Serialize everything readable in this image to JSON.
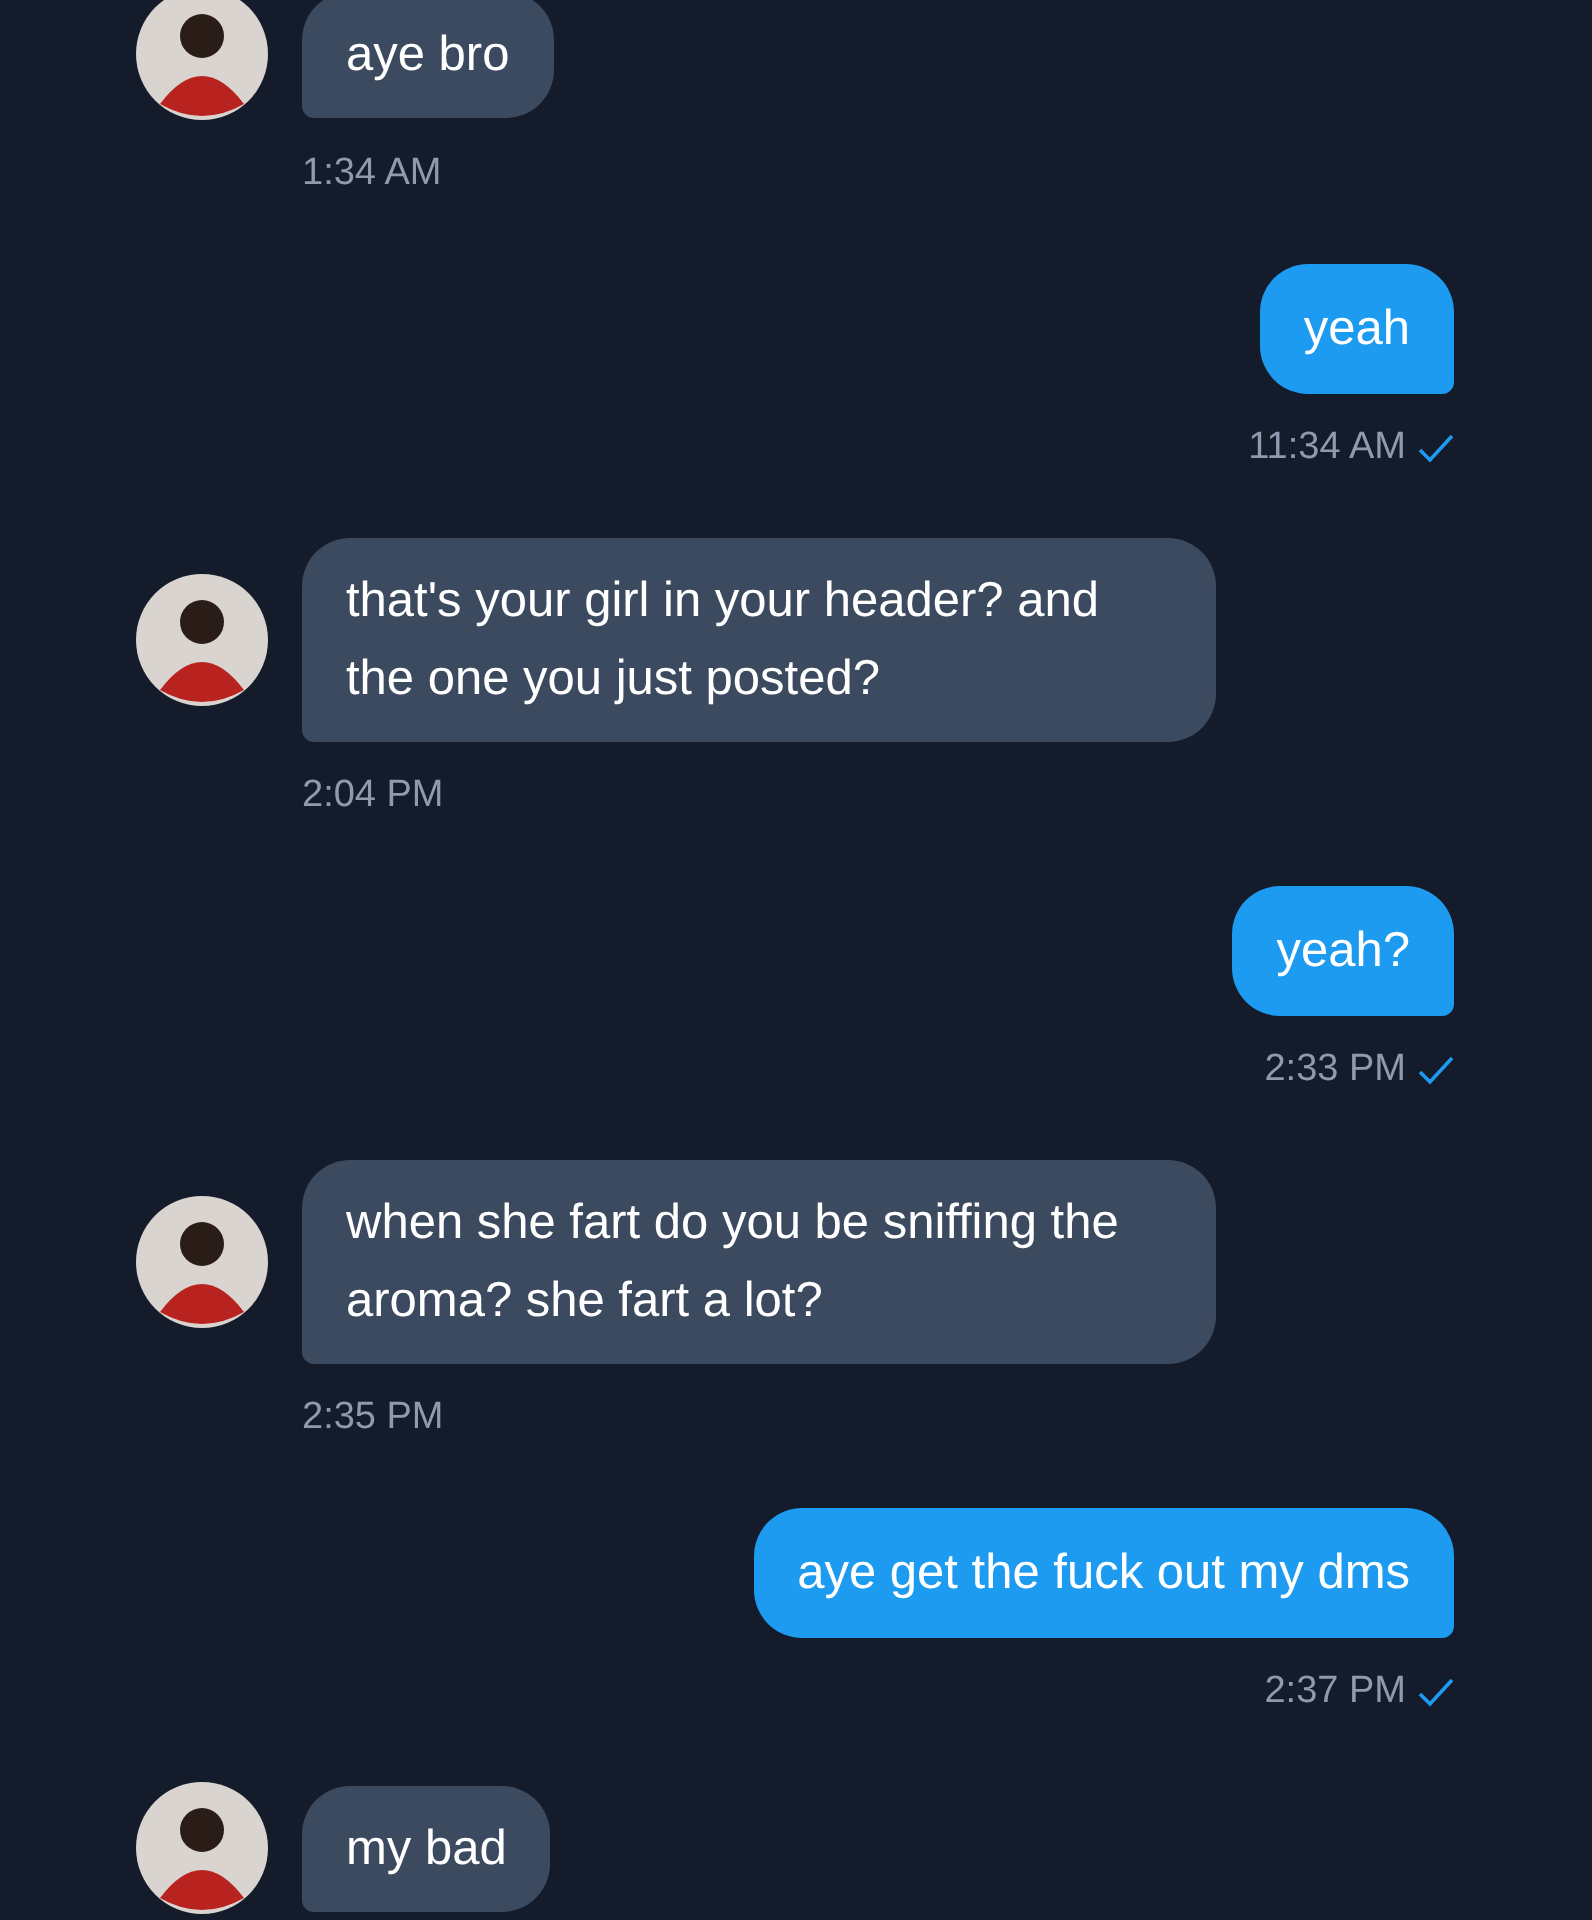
{
  "messages": [
    {
      "kind": "incoming",
      "text": "aye bro",
      "time": "1:34 AM"
    },
    {
      "kind": "outgoing",
      "text": "yeah",
      "time": "11:34 AM",
      "read": true
    },
    {
      "kind": "incoming",
      "text": "that's your girl in your header? and the one you just posted?",
      "time": "2:04 PM"
    },
    {
      "kind": "outgoing",
      "text": "yeah?",
      "time": "2:33 PM",
      "read": true
    },
    {
      "kind": "incoming",
      "text": "when she fart do you be sniffing the aroma? she fart a lot?",
      "time": "2:35 PM"
    },
    {
      "kind": "outgoing",
      "text": "aye get the fuck out my dms",
      "time": "2:37 PM",
      "read": true
    },
    {
      "kind": "incoming",
      "text": "my bad"
    }
  ]
}
